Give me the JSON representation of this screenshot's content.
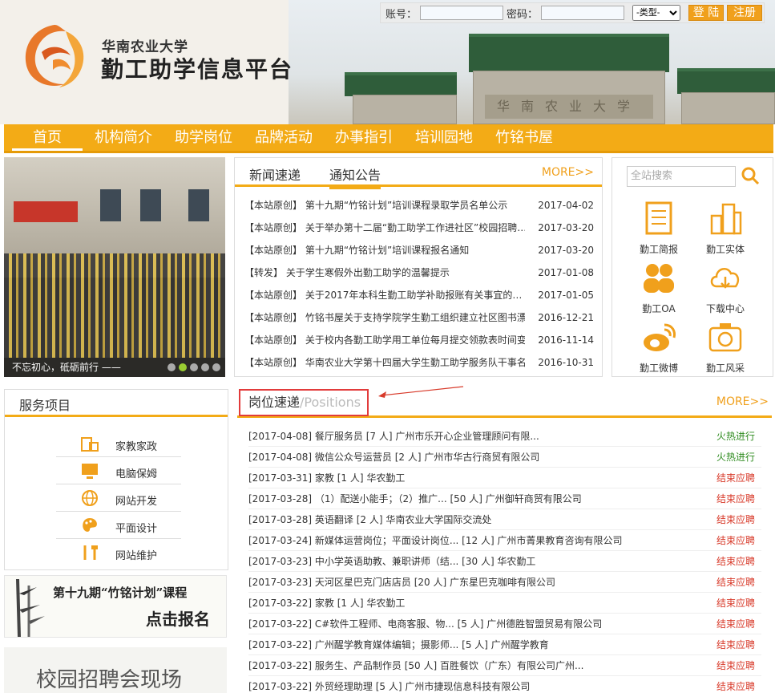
{
  "header": {
    "university": "华南农业大学",
    "platform": "勤工助学信息平台",
    "gate_text": "华南农业大学"
  },
  "login": {
    "account_label": "账号：",
    "password_label": "密码：",
    "type_option": "-类型-",
    "login_button": "登 陆",
    "register_button": "注册"
  },
  "nav": [
    "首页",
    "机构简介",
    "助学岗位",
    "品牌活动",
    "办事指引",
    "培训园地",
    "竹铭书屋"
  ],
  "slider": {
    "caption": "不忘初心，砥砺前行 ——"
  },
  "news": {
    "tabs": [
      "新闻速递",
      "通知公告"
    ],
    "more": "MORE>>",
    "items": [
      {
        "title": "【本站原创】 第十九期“竹铭计划”培训课程录取学员名单公示",
        "date": "2017-04-02"
      },
      {
        "title": "【本站原创】 关于举办第十二届“勤工助学工作进社区”校园招聘…",
        "date": "2017-03-20"
      },
      {
        "title": "【本站原创】 第十九期“竹铭计划”培训课程报名通知",
        "date": "2017-03-20"
      },
      {
        "title": "【转发】 关于学生寒假外出勤工助学的温馨提示",
        "date": "2017-01-08"
      },
      {
        "title": "【本站原创】 关于2017年本科生勤工助学补助报账有关事宜的…",
        "date": "2017-01-05"
      },
      {
        "title": "【本站原创】 竹铭书屋关于支持学院学生勤工组织建立社区图书漂…",
        "date": "2016-12-21"
      },
      {
        "title": "【本站原创】 关于校内各勤工助学用工单位每月提交领款表时间变…",
        "date": "2016-11-14"
      },
      {
        "title": "【本站原创】 华南农业大学第十四届大学生勤工助学服务队干事名…",
        "date": "2016-10-31"
      }
    ]
  },
  "quick": {
    "search_placeholder": "全站搜索",
    "items": [
      "勤工简报",
      "勤工实体",
      "勤工OA",
      "下载中心",
      "勤工微博",
      "勤工风采"
    ]
  },
  "services": {
    "title": "服务项目",
    "items": [
      "家教家政",
      "电脑保姆",
      "网站开发",
      "平面设计",
      "网站维护"
    ]
  },
  "banners": {
    "zhuming": "第十九期“竹铭计划”课程",
    "zhuming_cta": "点击报名",
    "campus": "校园招聘会现场"
  },
  "positions": {
    "title": "岗位速递",
    "title_en": "/Positions",
    "more": "MORE>>",
    "items": [
      {
        "text": "[2017-04-08] 餐厅服务员 [7 人] 广州市乐开心企业管理顾问有限...",
        "status": "火热进行"
      },
      {
        "text": "[2017-04-08] 微信公众号运营员 [2 人] 广州市华古行商贸有限公司",
        "status": "火热进行"
      },
      {
        "text": "[2017-03-31] 家教 [1 人] 华农勤工",
        "status": "结束应聘"
      },
      {
        "text": "[2017-03-28] （1）配送小能手；（2）推广... [50 人] 广州御轩商贸有限公司",
        "status": "结束应聘"
      },
      {
        "text": "[2017-03-28] 英语翻译 [2 人] 华南农业大学国际交流处",
        "status": "结束应聘"
      },
      {
        "text": "[2017-03-24] 新媒体运营岗位；平面设计岗位... [12 人] 广州市菁果教育咨询有限公司",
        "status": "结束应聘"
      },
      {
        "text": "[2017-03-23] 中小学英语助教、兼职讲师（结... [30 人] 华农勤工",
        "status": "结束应聘"
      },
      {
        "text": "[2017-03-23] 天河区星巴克门店店员 [20 人] 广东星巴克咖啡有限公司",
        "status": "结束应聘"
      },
      {
        "text": "[2017-03-22] 家教 [1 人] 华农勤工",
        "status": "结束应聘"
      },
      {
        "text": "[2017-03-22] C#软件工程师、电商客服、物... [5 人] 广州德胜智盟贸易有限公司",
        "status": "结束应聘"
      },
      {
        "text": "[2017-03-22] 广州醒学教育媒体编辑；摄影师... [5 人] 广州醒学教育",
        "status": "结束应聘"
      },
      {
        "text": "[2017-03-22] 服务生、产品制作员 [50 人] 百胜餐饮（广东）有限公司广州...",
        "status": "结束应聘"
      },
      {
        "text": "[2017-03-22] 外贸经理助理 [5 人] 广州市捷现信息科技有限公司",
        "status": "结束应聘"
      }
    ]
  },
  "colors": {
    "accent": "#f3ab16",
    "hot": "#2e8b1e",
    "ended": "#d83a2a",
    "highlight": "#e23b3b"
  }
}
